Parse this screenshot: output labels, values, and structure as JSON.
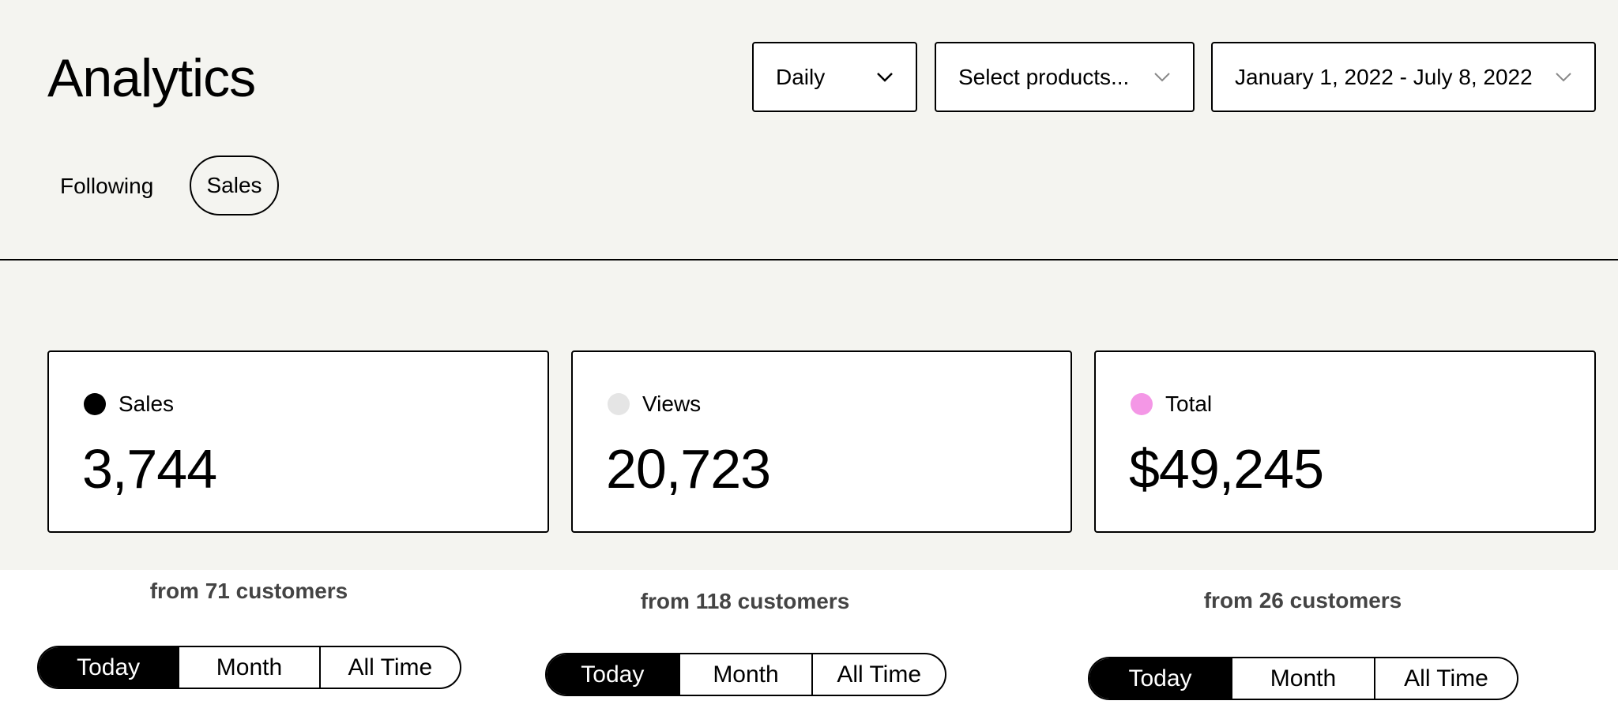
{
  "header": {
    "title": "Analytics",
    "frequency_dropdown": "Daily",
    "products_dropdown": "Select products...",
    "date_range_dropdown": "January 1, 2022 - July 8, 2022"
  },
  "tabs": [
    {
      "label": "Following",
      "active": false
    },
    {
      "label": "Sales",
      "active": true
    }
  ],
  "cards": [
    {
      "label": "Sales",
      "value": "3,744",
      "dot_color": "#000000",
      "customers": "from 71 customers"
    },
    {
      "label": "Views",
      "value": "20,723",
      "dot_color": "#e5e5e5",
      "customers": "from 118 customers"
    },
    {
      "label": "Total",
      "value": "$49,245",
      "dot_color": "#f497e6",
      "customers": "from 26 customers"
    }
  ],
  "period_toggle": {
    "options": [
      "Today",
      "Month",
      "All Time"
    ],
    "selected": "Today"
  },
  "icons": {
    "dropdown": "chevron-down-icon"
  }
}
